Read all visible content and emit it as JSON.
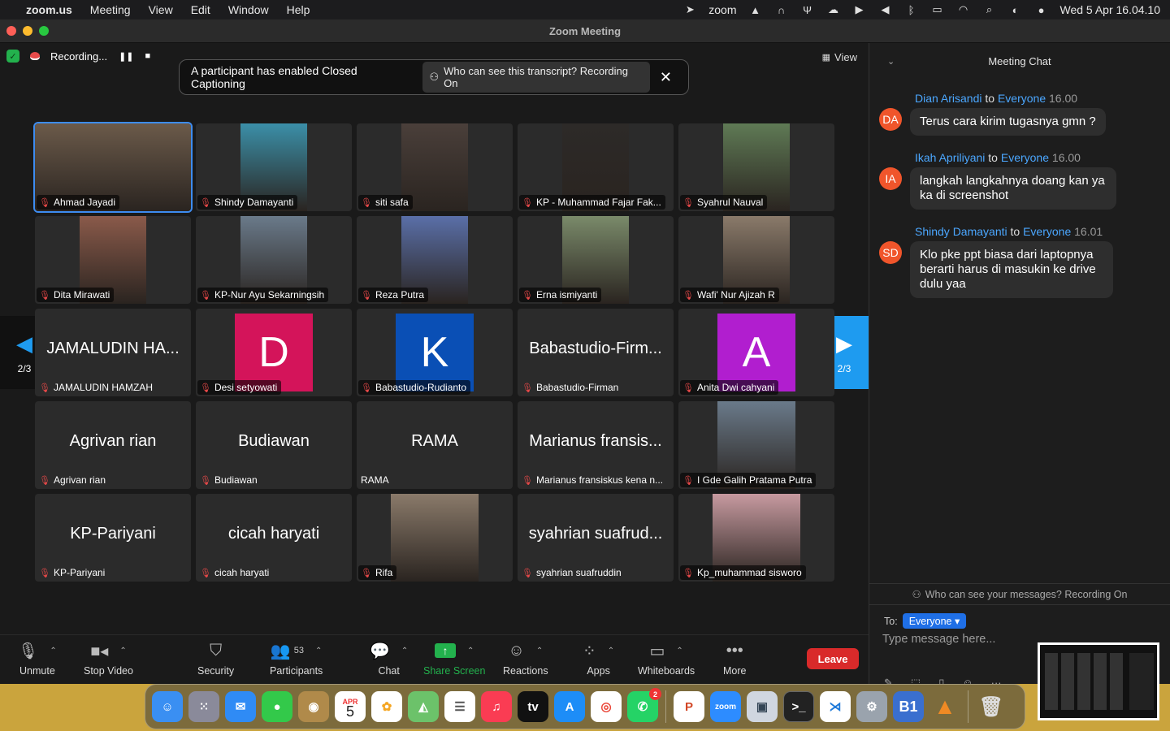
{
  "menubar": {
    "app": "zoom.us",
    "items": [
      "Meeting",
      "View",
      "Edit",
      "Window",
      "Help"
    ],
    "zoom_label": "zoom",
    "clock": "Wed 5 Apr  16.04.10"
  },
  "window": {
    "title": "Zoom Meeting"
  },
  "status": {
    "recording": "Recording..."
  },
  "view_label": "View",
  "cc_banner": {
    "text": "A participant has enabled Closed Captioning",
    "pill": "Who can see this transcript? Recording On"
  },
  "pager": {
    "left": "2/3",
    "right": "2/3"
  },
  "tiles": [
    {
      "name": "Ahmad Jayadi",
      "type": "video",
      "active": true
    },
    {
      "name": "Shindy Damayanti",
      "type": "video"
    },
    {
      "name": "siti safa",
      "type": "video"
    },
    {
      "name": "KP - Muhammad Fajar Fak...",
      "type": "video"
    },
    {
      "name": "Syahrul Nauval",
      "type": "video"
    },
    {
      "name": "Dita Mirawati",
      "type": "video"
    },
    {
      "name": "KP-Nur Ayu Sekarningsih",
      "type": "video"
    },
    {
      "name": "Reza Putra",
      "type": "video"
    },
    {
      "name": "Erna ismiyanti",
      "type": "video"
    },
    {
      "name": "Wafi' Nur Ajizah R",
      "type": "video"
    },
    {
      "name": "JAMALUDIN HAMZAH",
      "big": "JAMALUDIN HA...",
      "type": "text"
    },
    {
      "name": "Desi setyowati",
      "type": "avatar",
      "letter": "D",
      "color": "#d4145a"
    },
    {
      "name": "Babastudio-Rudianto",
      "type": "avatar",
      "letter": "K",
      "color": "#0a4fb5"
    },
    {
      "name": "Babastudio-Firman",
      "big": "Babastudio-Firm...",
      "type": "text"
    },
    {
      "name": "Anita Dwi cahyani",
      "type": "avatar",
      "letter": "A",
      "color": "#b11ecf"
    },
    {
      "name": "Agrivan rian",
      "big": "Agrivan rian",
      "type": "text"
    },
    {
      "name": "Budiawan",
      "big": "Budiawan",
      "type": "text"
    },
    {
      "name": "RAMA",
      "big": "RAMA",
      "type": "text",
      "mic": false
    },
    {
      "name": "Marianus fransiskus kena n...",
      "big": "Marianus fransis...",
      "type": "text"
    },
    {
      "name": "I Gde Galih Pratama Putra",
      "type": "video"
    },
    {
      "name": "KP-Pariyani",
      "big": "KP-Pariyani",
      "type": "text"
    },
    {
      "name": "cicah haryati",
      "big": "cicah haryati",
      "type": "text"
    },
    {
      "name": "Rifa",
      "type": "video"
    },
    {
      "name": "syahrian suafruddin",
      "big": "syahrian suafrud...",
      "type": "text"
    },
    {
      "name": "Kp_muhammad sisworo",
      "type": "video"
    }
  ],
  "toolbar": {
    "unmute": "Unmute",
    "stop_video": "Stop Video",
    "security": "Security",
    "participants": "Participants",
    "participants_count": "53",
    "chat": "Chat",
    "share": "Share Screen",
    "reactions": "Reactions",
    "apps": "Apps",
    "whiteboards": "Whiteboards",
    "more": "More",
    "leave": "Leave"
  },
  "chat": {
    "title": "Meeting Chat",
    "to_word": "to",
    "messages": [
      {
        "initials": "DA",
        "from": "Dian Arisandi",
        "to": "Everyone",
        "time": "16.00",
        "text": "Terus cara kirim tugasnya gmn ?"
      },
      {
        "initials": "IA",
        "from": "Ikah Apriliyani",
        "to": "Everyone",
        "time": "16.00",
        "text": "langkah langkahnya doang kan ya ka di screenshot"
      },
      {
        "initials": "SD",
        "from": "Shindy Damayanti",
        "to": "Everyone",
        "time": "16.01",
        "text": "Klo pke ppt biasa dari laptopnya berarti harus di masukin ke drive dulu yaa"
      }
    ],
    "notice": "Who can see your messages? Recording On",
    "to_label": "To:",
    "to_value": "Everyone",
    "placeholder": "Type message here..."
  },
  "dock": {
    "calendar_month": "APR",
    "calendar_day": "5",
    "whatsapp_badge": "2",
    "zoom_label": "zoom",
    "b1_label": "B1"
  }
}
